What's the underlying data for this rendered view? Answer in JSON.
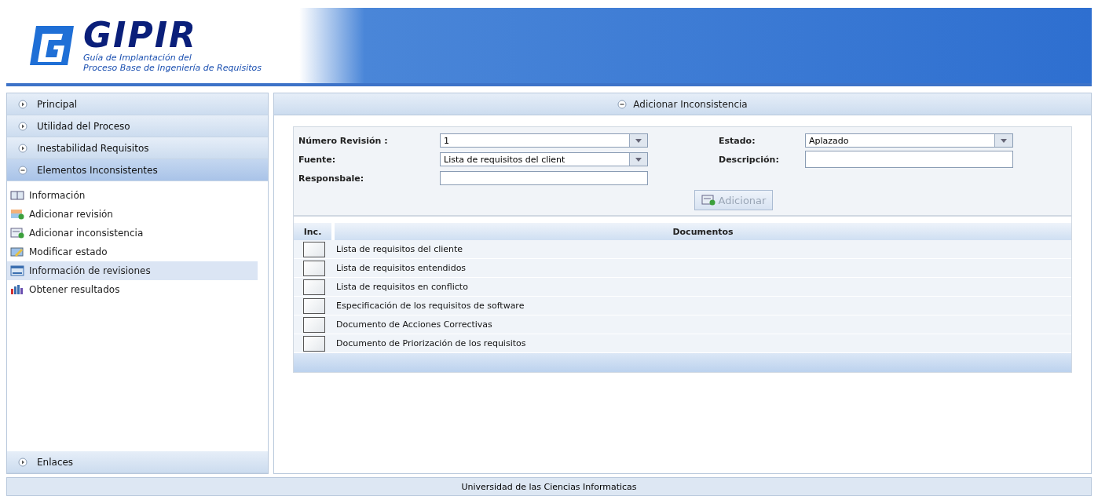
{
  "header": {
    "logo": "GIPIR",
    "subtitle_lines": [
      "Guía de Implantación del",
      "Proceso Base de Ingeniería de Requisitos"
    ]
  },
  "sidebar": {
    "sections": [
      {
        "label": "Principal",
        "expanded": false
      },
      {
        "label": "Utilidad del Proceso",
        "expanded": false
      },
      {
        "label": "Inestabilidad Requisitos",
        "expanded": false
      },
      {
        "label": "Elementos Inconsistentes",
        "expanded": true,
        "items": [
          {
            "label": "Información",
            "selected": false
          },
          {
            "label": "Adicionar revisión",
            "selected": false
          },
          {
            "label": "Adicionar inconsistencia",
            "selected": false
          },
          {
            "label": "Modificar estado",
            "selected": false
          },
          {
            "label": "Información de revisiones",
            "selected": true
          },
          {
            "label": "Obtener resultados",
            "selected": false
          }
        ]
      }
    ],
    "footer_section": {
      "label": "Enlaces",
      "expanded": false
    }
  },
  "panel": {
    "title": "Adicionar Inconsistencia",
    "fields": [
      {
        "label": "Número Revisión :",
        "kind": "select",
        "value": "1"
      },
      {
        "label": "Estado:",
        "kind": "select",
        "value": "Aplazado"
      },
      {
        "label": "Fuente:",
        "kind": "select",
        "value": "Lista de requisitos del client"
      },
      {
        "label": "Descripción:",
        "kind": "textarea"
      },
      {
        "label": "Responsbale:",
        "kind": "text"
      }
    ],
    "add_button": {
      "label": "Adicionar",
      "disabled": true
    },
    "table": {
      "columns": [
        "Inc.",
        "Documentos"
      ],
      "rows": [
        {
          "checked": false,
          "document": "Lista de requisitos del cliente"
        },
        {
          "checked": false,
          "document": "Lista de requisitos entendidos"
        },
        {
          "checked": false,
          "document": "Lista de requisitos en conflicto"
        },
        {
          "checked": false,
          "document": "Especificación de los requisitos de software"
        },
        {
          "checked": false,
          "document": "Documento de Acciones Correctivas"
        },
        {
          "checked": false,
          "document": "Documento de Priorización de los requisitos"
        }
      ]
    }
  },
  "status_bar": "Universidad de las Ciencias Informaticas"
}
